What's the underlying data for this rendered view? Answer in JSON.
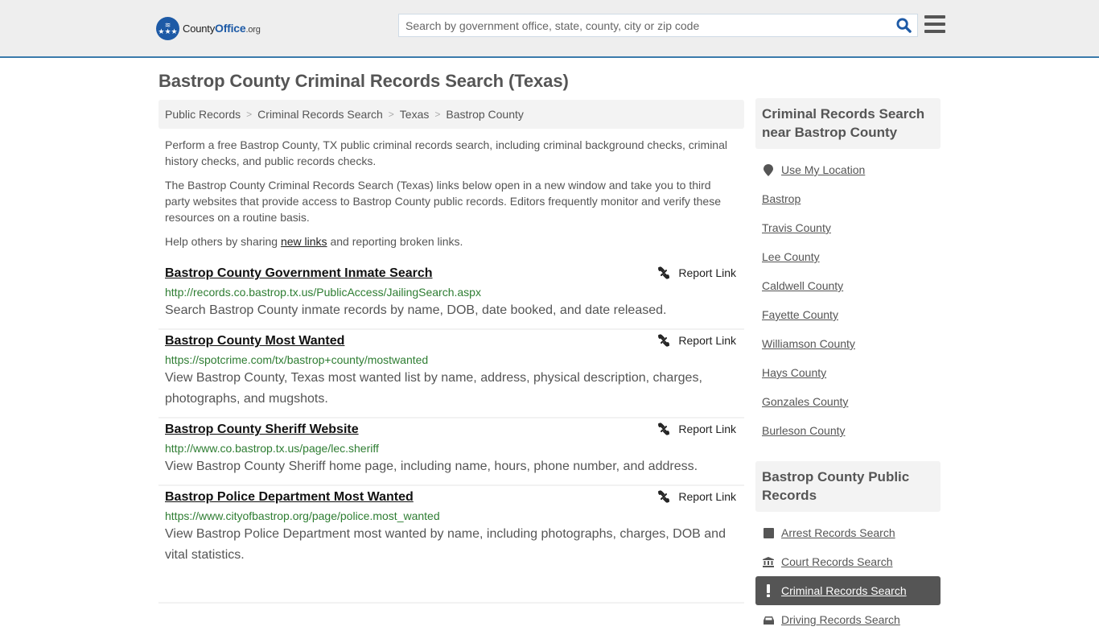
{
  "header": {
    "logo": {
      "part1": "County",
      "part2": "Office",
      "part3": ".org"
    },
    "search_placeholder": "Search by government office, state, county, city or zip code",
    "search_value": ""
  },
  "page_title": "Bastrop County Criminal Records Search (Texas)",
  "breadcrumb": [
    {
      "label": "Public Records"
    },
    {
      "label": "Criminal Records Search"
    },
    {
      "label": "Texas"
    },
    {
      "label": "Bastrop County"
    }
  ],
  "intro": {
    "p1": "Perform a free Bastrop County, TX public criminal records search, including criminal background checks, criminal history checks, and public records checks.",
    "p2": "The Bastrop County Criminal Records Search (Texas) links below open in a new window and take you to third party websites that provide access to Bastrop County public records. Editors frequently monitor and verify these resources on a routine basis.",
    "p3_before": "Help others by sharing ",
    "p3_link": "new links",
    "p3_after": " and reporting broken links."
  },
  "report_label": "Report Link",
  "links": [
    {
      "title": "Bastrop County Government Inmate Search",
      "url": "http://records.co.bastrop.tx.us/PublicAccess/JailingSearch.aspx",
      "desc": "Search Bastrop County inmate records by name, DOB, date booked, and date released."
    },
    {
      "title": "Bastrop County Most Wanted",
      "url": "https://spotcrime.com/tx/bastrop+county/mostwanted",
      "desc": "View Bastrop County, Texas most wanted list by name, address, physical description, charges, photographs, and mugshots."
    },
    {
      "title": "Bastrop County Sheriff Website",
      "url": "http://www.co.bastrop.tx.us/page/lec.sheriff",
      "desc": "View Bastrop County Sheriff home page, including name, hours, phone number, and address."
    },
    {
      "title": "Bastrop Police Department Most Wanted",
      "url": "https://www.cityofbastrop.org/page/police.most_wanted",
      "desc": "View Bastrop Police Department most wanted by name, including photographs, charges, DOB and vital statistics."
    }
  ],
  "sidebar": {
    "nearby_title": "Criminal Records Search near Bastrop County",
    "use_location": "Use My Location",
    "nearby": [
      "Bastrop",
      "Travis County",
      "Lee County",
      "Caldwell County",
      "Fayette County",
      "Williamson County",
      "Hays County",
      "Gonzales County",
      "Burleson County"
    ],
    "public_title": "Bastrop County Public Records",
    "public_records": [
      {
        "label": "Arrest Records Search",
        "icon": "square-icon",
        "active": false
      },
      {
        "label": "Court Records Search",
        "icon": "courthouse-icon",
        "active": false
      },
      {
        "label": "Criminal Records Search",
        "icon": "exclamation-icon",
        "active": true
      },
      {
        "label": "Driving Records Search",
        "icon": "car-icon",
        "active": false
      }
    ]
  },
  "colors": {
    "accent": "#3a7bab",
    "brand": "#1d5aa6",
    "url_green": "#2e7d32",
    "active_bg": "#555555"
  }
}
